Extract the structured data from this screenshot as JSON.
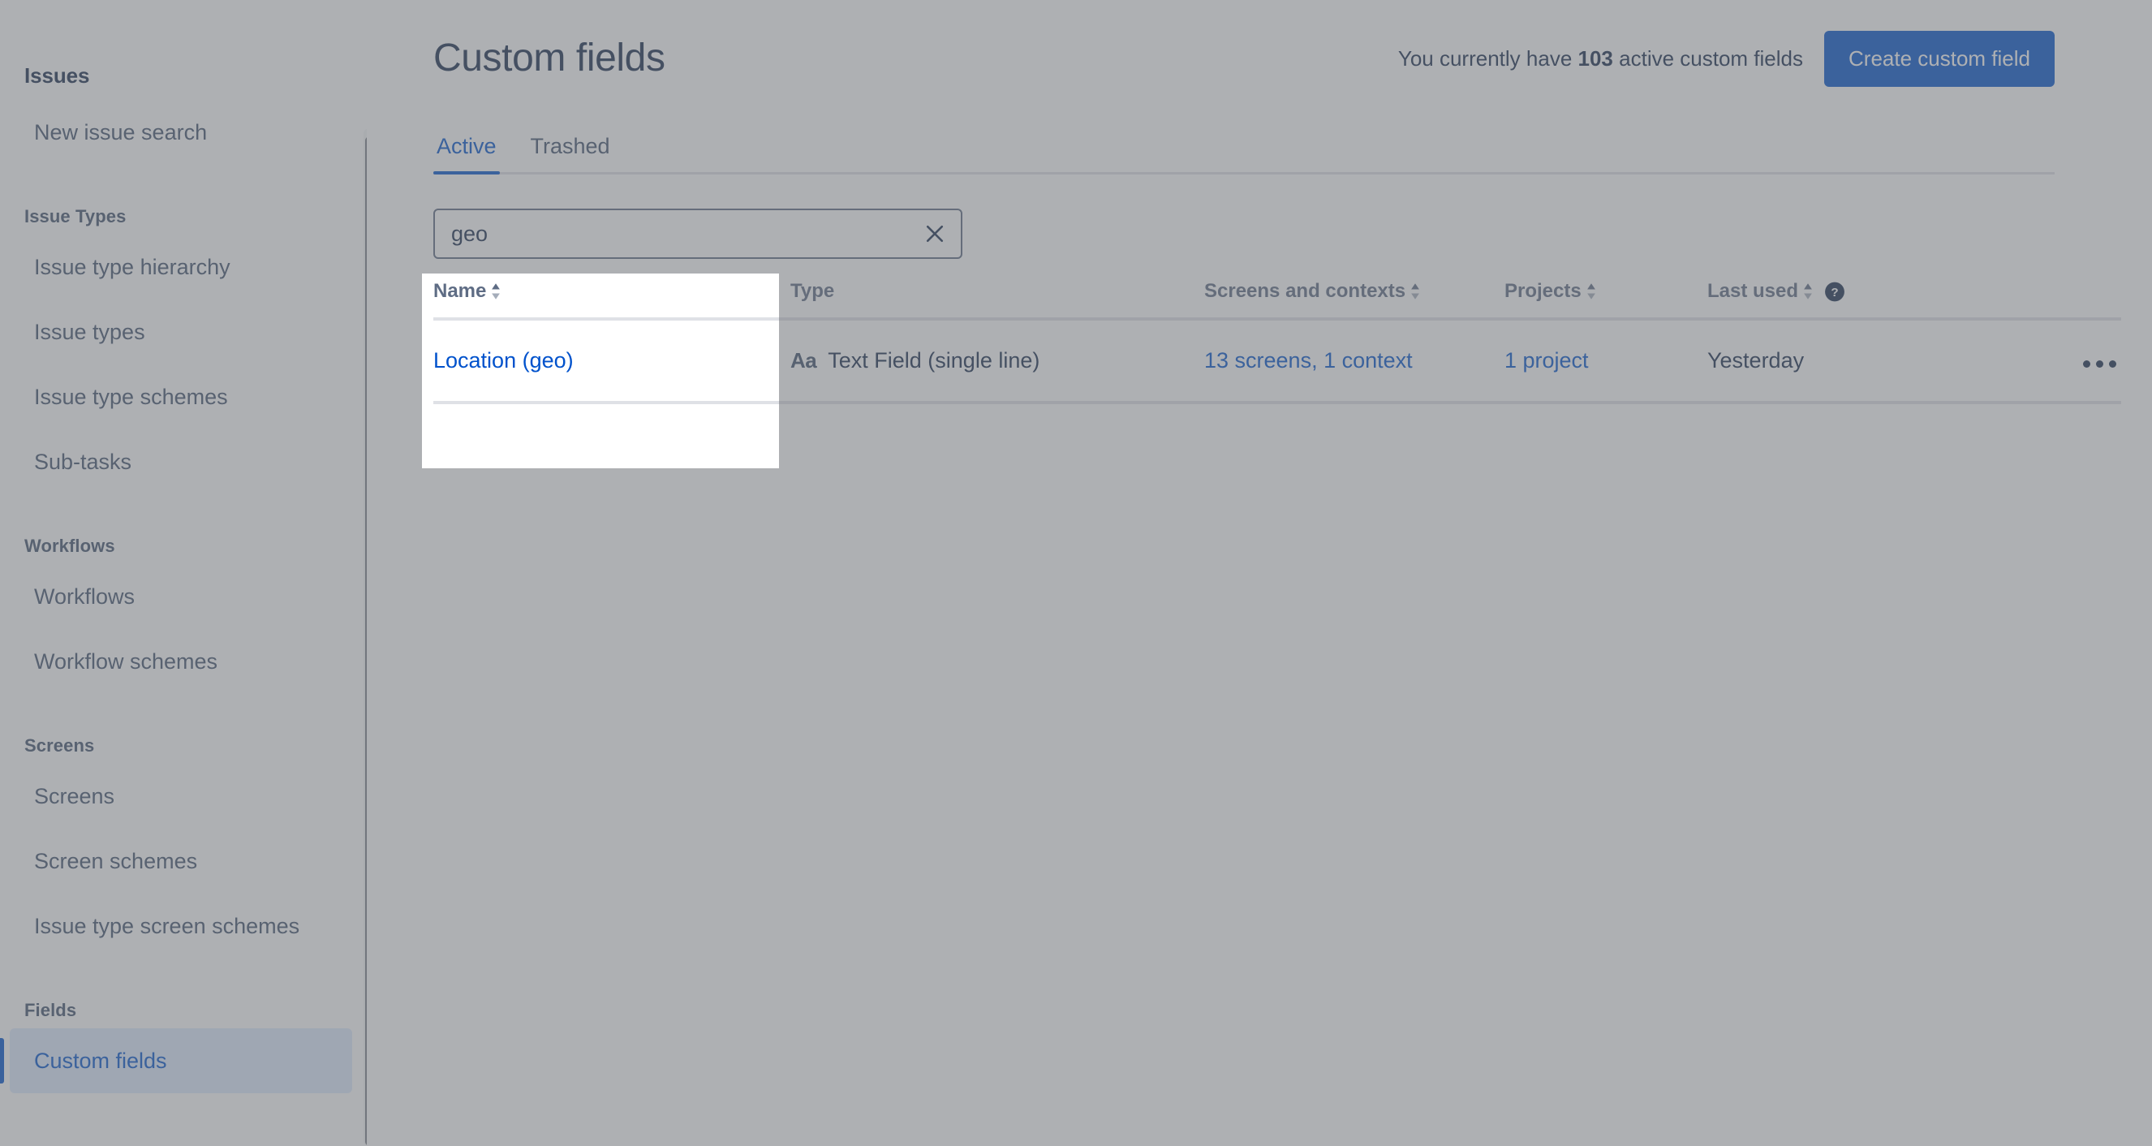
{
  "sidebar": {
    "title": "Issues",
    "items": [
      {
        "kind": "link",
        "label": "New issue search",
        "name": "new-issue-search"
      },
      {
        "kind": "section",
        "label": "Issue Types",
        "name": "issue-types"
      },
      {
        "kind": "link",
        "label": "Issue type hierarchy",
        "name": "issue-type-hierarchy"
      },
      {
        "kind": "link",
        "label": "Issue types",
        "name": "issue-types-link"
      },
      {
        "kind": "link",
        "label": "Issue type schemes",
        "name": "issue-type-schemes"
      },
      {
        "kind": "link",
        "label": "Sub-tasks",
        "name": "sub-tasks"
      },
      {
        "kind": "section",
        "label": "Workflows",
        "name": "workflows"
      },
      {
        "kind": "link",
        "label": "Workflows",
        "name": "workflows-link"
      },
      {
        "kind": "link",
        "label": "Workflow schemes",
        "name": "workflow-schemes"
      },
      {
        "kind": "section",
        "label": "Screens",
        "name": "screens"
      },
      {
        "kind": "link",
        "label": "Screens",
        "name": "screens-link"
      },
      {
        "kind": "link",
        "label": "Screen schemes",
        "name": "screen-schemes"
      },
      {
        "kind": "link",
        "label": "Issue type screen schemes",
        "name": "issue-type-screen-schemes"
      },
      {
        "kind": "section",
        "label": "Fields",
        "name": "fields"
      },
      {
        "kind": "link",
        "label": "Custom fields",
        "name": "custom-fields",
        "selected": true
      }
    ]
  },
  "header": {
    "title": "Custom fields",
    "count_prefix": "You currently have",
    "count_value": "103",
    "count_suffix": "active custom fields",
    "create_button": "Create custom field"
  },
  "tabs": [
    {
      "label": "Active",
      "active": true
    },
    {
      "label": "Trashed",
      "active": false
    }
  ],
  "search": {
    "value": "geo",
    "placeholder": "Search custom fields",
    "clear_icon": "close-icon"
  },
  "table": {
    "columns": [
      {
        "label": "Name",
        "sortable": true,
        "help": false
      },
      {
        "label": "Type",
        "sortable": false,
        "help": false
      },
      {
        "label": "Screens and contexts",
        "sortable": true,
        "help": false
      },
      {
        "label": "Projects",
        "sortable": true,
        "help": false
      },
      {
        "label": "Last used",
        "sortable": true,
        "help": true
      },
      {
        "label": "",
        "sortable": false,
        "help": false
      }
    ],
    "rows": [
      {
        "name": "Location (geo)",
        "type_icon": "Aa",
        "type": "Text Field (single line)",
        "screens": "13 screens, 1 context",
        "projects": "1 project",
        "last_used": "Yesterday",
        "actions_icon": "more-horizontal-icon"
      }
    ]
  },
  "colors": {
    "brand_blue": "#0052cc",
    "link_blue": "#0052cc",
    "text_dark": "#172b4d",
    "text_muted": "#5e6c84",
    "border": "#dfe1e6",
    "selected_bg": "#deebff"
  }
}
